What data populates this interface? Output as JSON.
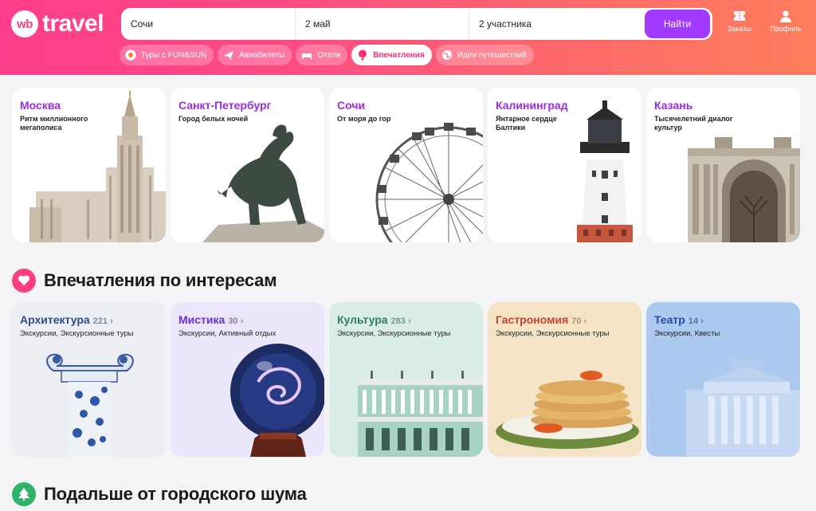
{
  "header": {
    "logo_badge": "wb",
    "logo_text": "travel",
    "search": {
      "destination": "Сочи",
      "date": "2 май",
      "guests": "2 участника",
      "button_label": "Найти"
    },
    "orders_label": "Заказы",
    "profile_label": "Профиль",
    "pills": [
      {
        "label": "Туры с FUN&SUN",
        "icon": "sun-icon"
      },
      {
        "label": "Авиабилеты",
        "icon": "plane-icon"
      },
      {
        "label": "Отели",
        "icon": "bed-icon"
      },
      {
        "label": "Впечатления",
        "icon": "balloon-icon",
        "active": true
      },
      {
        "label": "Идеи путешествий",
        "icon": "globe-icon"
      }
    ]
  },
  "cities": [
    {
      "name": "Москва",
      "subtitle": "Ритм миллионного мегаполиса"
    },
    {
      "name": "Санкт-Петербург",
      "subtitle": "Город белых ночей"
    },
    {
      "name": "Сочи",
      "subtitle": "От моря до гор"
    },
    {
      "name": "Калининград",
      "subtitle": "Янтарное сердце Балтики"
    },
    {
      "name": "Казань",
      "subtitle": "Тысячелетний диалог культур"
    }
  ],
  "interests_section": {
    "title": "Впечатления по интересам",
    "items": [
      {
        "title": "Архитектура",
        "count": "221",
        "desc": "Экскурсии, Экскурсионные туры",
        "title_color": "#2e4a8f",
        "bg": "#eceef3"
      },
      {
        "title": "Мистика",
        "count": "30",
        "desc": "Экскурсии, Активный отдых",
        "title_color": "#6a2fd6",
        "bg": "#ece6fb"
      },
      {
        "title": "Культура",
        "count": "283",
        "desc": "Экскурсии, Экскурсионные туры",
        "title_color": "#2e7d5b",
        "bg": "#d9ede6"
      },
      {
        "title": "Гастрономия",
        "count": "70",
        "desc": "Экскурсии, Экскурсионные туры",
        "title_color": "#c4452a",
        "bg": "#f5e3c6"
      },
      {
        "title": "Театр",
        "count": "14",
        "desc": "Экскурсии, Квесты",
        "title_color": "#1f4fa8",
        "bg": "#acc9ef"
      }
    ]
  },
  "nature_section": {
    "title": "Подальше от городского шума"
  }
}
